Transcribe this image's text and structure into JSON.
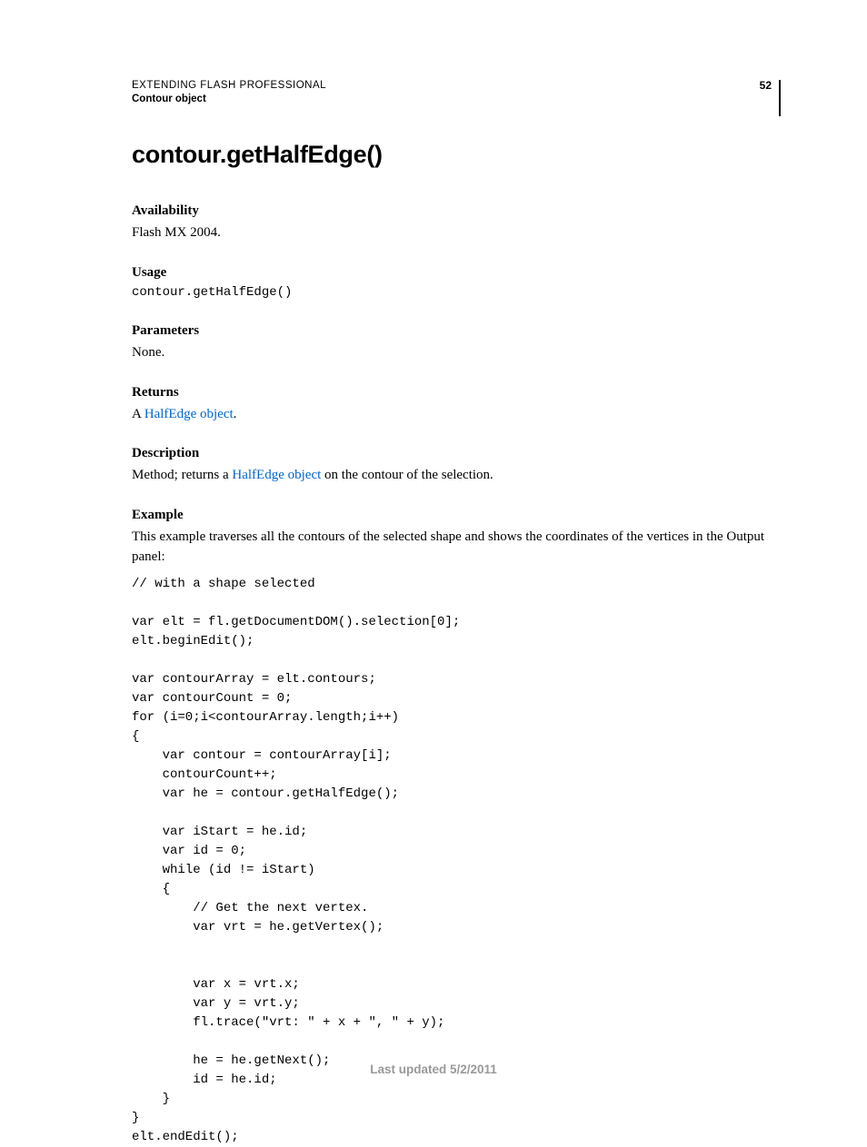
{
  "header": {
    "line1": "EXTENDING FLASH PROFESSIONAL",
    "line2": "Contour object",
    "page_number": "52"
  },
  "title": "contour.getHalfEdge()",
  "sections": {
    "availability": {
      "label": "Availability",
      "text": "Flash MX 2004."
    },
    "usage": {
      "label": "Usage",
      "code": "contour.getHalfEdge()"
    },
    "parameters": {
      "label": "Parameters",
      "text": "None."
    },
    "returns": {
      "label": "Returns",
      "prefix": "A ",
      "link": "HalfEdge object",
      "suffix": "."
    },
    "description": {
      "label": "Description",
      "prefix": "Method; returns a ",
      "link": "HalfEdge object",
      "suffix": " on the contour of the selection."
    },
    "example": {
      "label": "Example",
      "text": "This example traverses all the contours of the selected shape and shows the coordinates of the vertices in the Output panel:",
      "code": "// with a shape selected \n\nvar elt = fl.getDocumentDOM().selection[0]; \nelt.beginEdit(); \n\nvar contourArray = elt.contours; \nvar contourCount = 0; \nfor (i=0;i<contourArray.length;i++) \n{ \n    var contour = contourArray[i]; \n    contourCount++; \n    var he = contour.getHalfEdge(); \n\n    var iStart = he.id; \n    var id = 0; \n    while (id != iStart) \n    { \n        // Get the next vertex. \n        var vrt = he.getVertex(); \n\n\n        var x = vrt.x; \n        var y = vrt.y; \n        fl.trace(\"vrt: \" + x + \", \" + y); \n\n        he = he.getNext(); \n        id = he.id; \n    } \n} \nelt.endEdit();"
    }
  },
  "footer": "Last updated 5/2/2011"
}
